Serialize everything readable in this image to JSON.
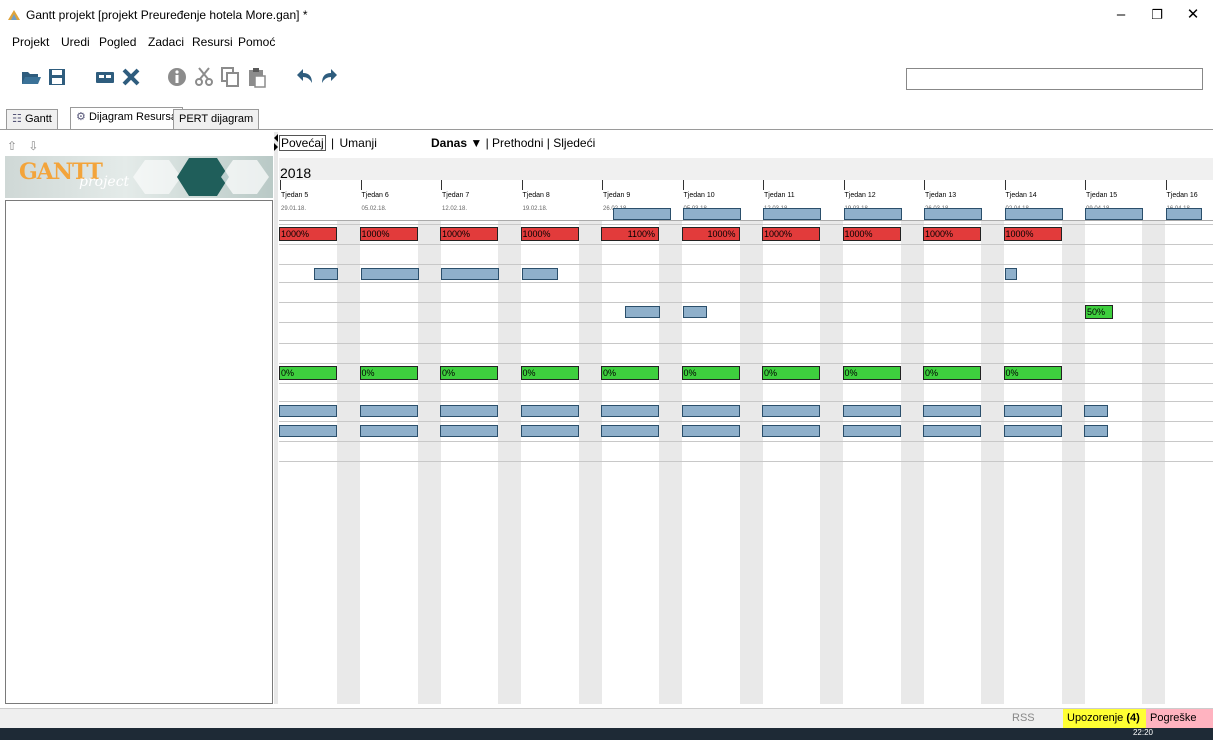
{
  "window": {
    "title": "Gantt projekt [projekt Preuređenje hotela More.gan] *",
    "minimize": "–",
    "restore": "❐",
    "close": "✕"
  },
  "menu": [
    {
      "label": "Projekt"
    },
    {
      "label": "Uredi"
    },
    {
      "label": "Pogled"
    },
    {
      "label": "Zadaci"
    },
    {
      "label": "Resursi"
    },
    {
      "label": "Pomoć"
    }
  ],
  "toolbar": {
    "icons": [
      "open-icon",
      "save-icon",
      "new-resource-icon",
      "delete-icon",
      "properties-icon",
      "cut-icon",
      "copy-icon",
      "paste-icon",
      "undo-icon",
      "redo-icon"
    ],
    "search_value": ""
  },
  "tabs": [
    {
      "label": "Gantt",
      "active": false
    },
    {
      "label": "Dijagram Resursa",
      "active": true
    },
    {
      "label": "PERT dijagram",
      "active": false
    }
  ],
  "left": {
    "arrows": "⇧ ⇩",
    "logo_main": "GANTT",
    "logo_sub": "project"
  },
  "chart": {
    "zoom_in": "Povećaj",
    "zoom_out": "Umanji",
    "separator": "|",
    "today": "Danas ▼",
    "previous": "Prethodni",
    "next": "Sljedeći",
    "year": "2018",
    "weeks": [
      {
        "label": "Tjedan 5",
        "date": "29.01.18."
      },
      {
        "label": "Tjedan 6",
        "date": "05.02.18."
      },
      {
        "label": "Tjedan 7",
        "date": "12.02.18."
      },
      {
        "label": "Tjedan 8",
        "date": "19.02.18."
      },
      {
        "label": "Tjedan 9",
        "date": "26.02.18."
      },
      {
        "label": "Tjedan 10",
        "date": "05.03.18."
      },
      {
        "label": "Tjedan 11",
        "date": "12.03.18."
      },
      {
        "label": "Tjedan 12",
        "date": "19.03.18."
      },
      {
        "label": "Tjedan 13",
        "date": "26.03.18."
      },
      {
        "label": "Tjedan 14",
        "date": "02.04.18."
      },
      {
        "label": "Tjedan 15",
        "date": "09.04.18."
      },
      {
        "label": "Tjedan 16",
        "date": "16.04.18."
      }
    ],
    "overload_labels": [
      "1000%",
      "1000%",
      "1000%",
      "1000%",
      "1100%",
      "1000%",
      "1000%",
      "1000%",
      "1000%",
      "1000%"
    ],
    "underload_labels": [
      "0%",
      "0%",
      "0%",
      "0%",
      "0%",
      "0%",
      "0%",
      "0%",
      "0%",
      "0%"
    ],
    "partial_label": "50%"
  },
  "status": {
    "rss": "RSS",
    "warnings": "Upozorenje",
    "warnings_count": "(4)",
    "errors": "Pogreške",
    "clock": "22:20"
  },
  "colors": {
    "overload": "#e23b3b",
    "underload": "#3ecf3e",
    "task_bar": "#8fb0cb",
    "warning_bg": "#ffff33",
    "error_bg": "#ffb3c0"
  }
}
